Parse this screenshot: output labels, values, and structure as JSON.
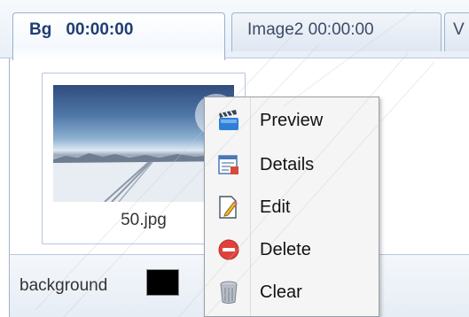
{
  "tabs": [
    {
      "title": "Bg",
      "time": "00:00:00",
      "active": true
    },
    {
      "label": "Image2 00:00:00",
      "active": false
    },
    {
      "label": "V",
      "active": false
    }
  ],
  "thumbnail": {
    "caption": "50.jpg",
    "image_icon": "snow-landscape-image"
  },
  "background": {
    "label": "background",
    "color": "#000000"
  },
  "context_menu": {
    "items": [
      {
        "label": "Preview",
        "icon": "clapperboard-icon"
      },
      {
        "label": "Details",
        "icon": "details-icon"
      },
      {
        "label": "Edit",
        "icon": "edit-icon"
      },
      {
        "label": "Delete",
        "icon": "delete-icon"
      },
      {
        "label": "Clear",
        "icon": "trash-icon"
      }
    ]
  },
  "colors": {
    "active_tab_text": "#1f3e74",
    "tab_border": "#98b0d2",
    "menu_background": "#f5f5f5",
    "delete_red": "#e0413a"
  }
}
